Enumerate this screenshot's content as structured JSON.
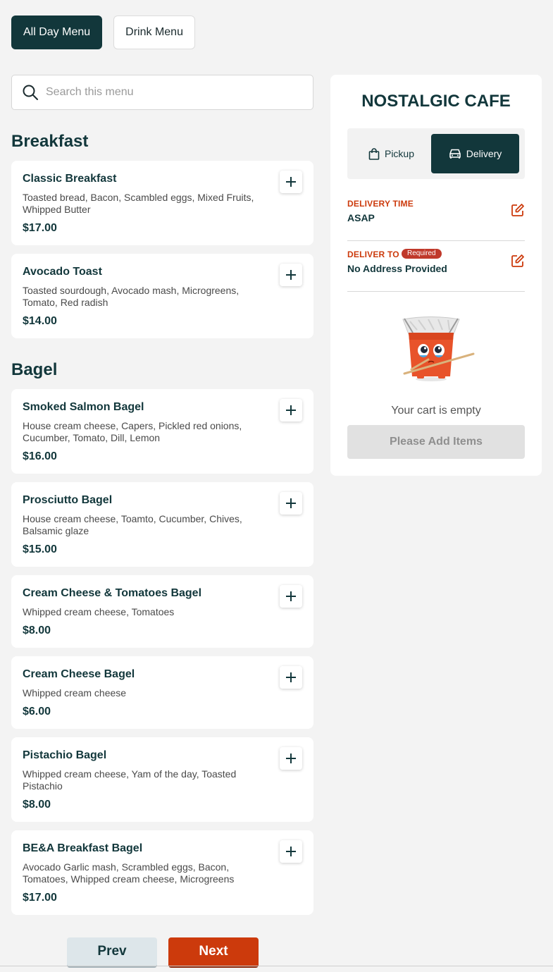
{
  "menu_tabs": [
    {
      "label": "All Day Menu",
      "active": true
    },
    {
      "label": "Drink Menu",
      "active": false
    }
  ],
  "search": {
    "placeholder": "Search this menu",
    "icon": "search-icon"
  },
  "sections": [
    {
      "title": "Breakfast",
      "items": [
        {
          "name": "Classic Breakfast",
          "description": "Toasted bread, Bacon, Scambled eggs, Mixed Fruits, Whipped Butter",
          "price": "$17.00"
        },
        {
          "name": "Avocado Toast",
          "description": "Toasted sourdough, Avocado mash, Microgreens, Tomato, Red radish",
          "price": "$14.00"
        }
      ]
    },
    {
      "title": "Bagel",
      "items": [
        {
          "name": "Smoked Salmon Bagel",
          "description": "House cream cheese, Capers, Pickled red onions, Cucumber, Tomato, Dill, Lemon",
          "price": "$16.00"
        },
        {
          "name": "Prosciutto Bagel",
          "description": "House cream cheese, Toamto, Cucumber, Chives, Balsamic glaze",
          "price": "$15.00"
        },
        {
          "name": "Cream Cheese & Tomatoes Bagel",
          "description": "Whipped cream cheese, Tomatoes",
          "price": "$8.00"
        },
        {
          "name": "Cream Cheese Bagel",
          "description": "Whipped cream cheese",
          "price": "$6.00"
        },
        {
          "name": "Pistachio Bagel",
          "description": "Whipped cream cheese, Yam of the day, Toasted Pistachio",
          "price": "$8.00"
        },
        {
          "name": "BE&A Breakfast Bagel",
          "description": "Avocado Garlic mash, Scrambled eggs, Bacon, Tomatoes, Whipped cream cheese, Microgreens",
          "price": "$17.00"
        }
      ]
    }
  ],
  "pagination": {
    "prev_label": "Prev",
    "next_label": "Next"
  },
  "cart": {
    "restaurant_name": "NOSTALGIC CAFE",
    "modes": [
      {
        "label": "Pickup",
        "icon": "shopping-bag-icon",
        "active": false
      },
      {
        "label": "Delivery",
        "icon": "car-icon",
        "active": true
      }
    ],
    "delivery_time": {
      "label": "DELIVERY TIME",
      "value": "ASAP"
    },
    "deliver_to": {
      "label": "DELIVER TO",
      "badge": "Required",
      "value": "No Address Provided"
    },
    "empty_text": "Your cart is empty",
    "add_items_label": "Please Add Items"
  },
  "colors": {
    "brand_dark": "#12373b",
    "accent": "#cc3a0c",
    "required_badge": "#c0392b"
  }
}
